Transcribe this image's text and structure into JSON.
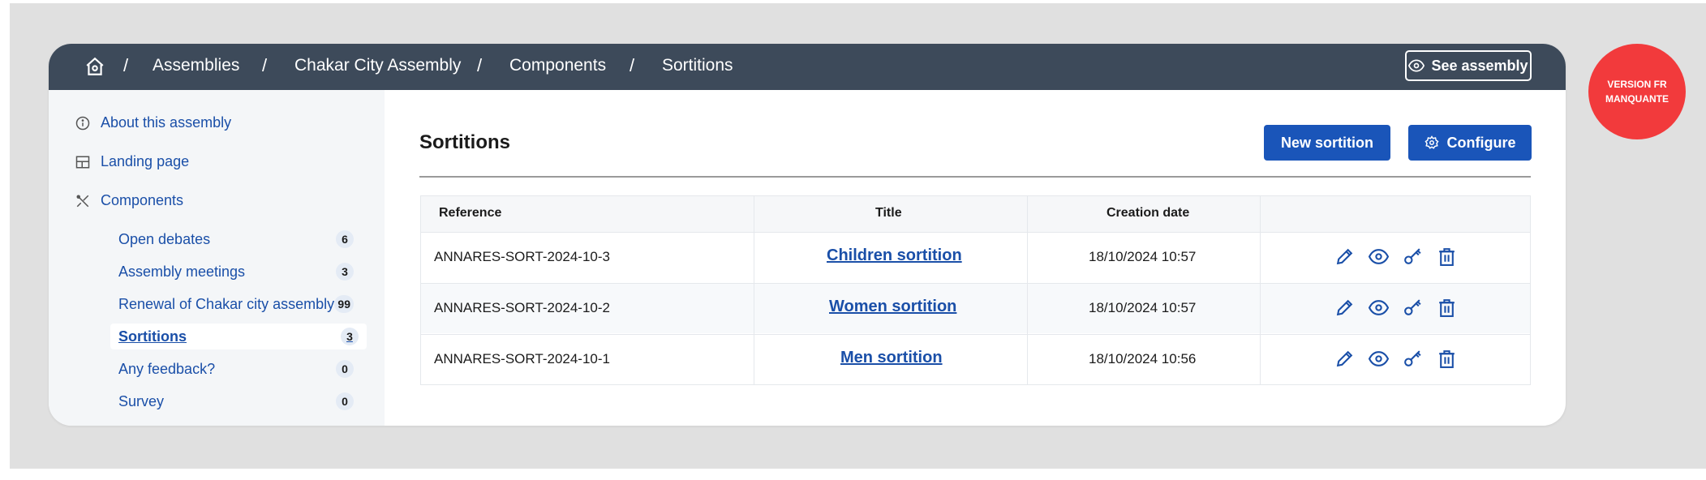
{
  "breadcrumb": {
    "items": [
      "Assemblies",
      "Chakar City Assembly",
      "Components",
      "Sortitions"
    ],
    "separator": "/"
  },
  "header": {
    "see_assembly_label": "See assembly"
  },
  "sidebar": {
    "main_items": [
      {
        "label": "About this assembly",
        "icon": "info-icon"
      },
      {
        "label": "Landing page",
        "icon": "layout-icon"
      },
      {
        "label": "Components",
        "icon": "tools-icon"
      }
    ],
    "components": [
      {
        "label": "Open debates",
        "count": "6"
      },
      {
        "label": "Assembly meetings",
        "count": "3"
      },
      {
        "label": "Renewal of Chakar city assembly",
        "count": "99"
      },
      {
        "label": "Sortitions",
        "count": "3",
        "active": true
      },
      {
        "label": "Any feedback?",
        "count": "0"
      },
      {
        "label": "Survey",
        "count": "0"
      }
    ]
  },
  "main": {
    "title": "Sortitions",
    "new_button": "New sortition",
    "configure_button": "Configure",
    "table": {
      "columns": [
        "Reference",
        "Title",
        "Creation date",
        ""
      ],
      "rows": [
        {
          "reference": "ANNARES-SORT-2024-10-3",
          "title": "Children sortition",
          "date": "18/10/2024 10:57"
        },
        {
          "reference": "ANNARES-SORT-2024-10-2",
          "title": "Women sortition",
          "date": "18/10/2024 10:57"
        },
        {
          "reference": "ANNARES-SORT-2024-10-1",
          "title": "Men sortition",
          "date": "18/10/2024 10:56"
        }
      ],
      "action_icons": [
        "pencil-icon",
        "eye-icon",
        "key-icon",
        "trash-icon"
      ]
    }
  },
  "version_badge": {
    "line1": "VERSION FR",
    "line2": "MANQUANTE"
  },
  "colors": {
    "topbar": "#3d4a5a",
    "accent": "#1a55b9",
    "link": "#1a4fa8",
    "badge": "#f23a3c"
  }
}
